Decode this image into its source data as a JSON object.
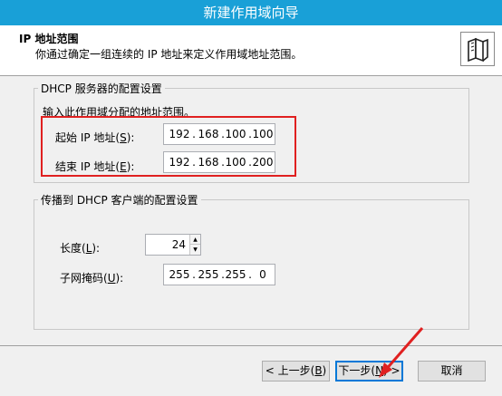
{
  "window": {
    "title": "新建作用域向导"
  },
  "header": {
    "title": "IP 地址范围",
    "description": "你通过确定一组连续的 IP 地址来定义作用域地址范围。"
  },
  "dhcp_group": {
    "legend": "DHCP 服务器的配置设置",
    "prompt": "输入此作用域分配的地址范围。",
    "start_label_pre": "起始 IP 地址(",
    "start_label_key": "S",
    "start_label_post": "):",
    "start_ip": [
      "192",
      "168",
      "100",
      "100"
    ],
    "end_label_pre": "结束 IP 地址(",
    "end_label_key": "E",
    "end_label_post": "):",
    "end_ip": [
      "192",
      "168",
      "100",
      "200"
    ]
  },
  "client_group": {
    "legend": "传播到 DHCP 客户端的配置设置",
    "length_label_pre": "长度(",
    "length_label_key": "L",
    "length_label_post": "):",
    "length_value": "24",
    "mask_label_pre": "子网掩码(",
    "mask_label_key": "U",
    "mask_label_post": "):",
    "mask": [
      "255",
      "255",
      "255",
      "0"
    ]
  },
  "footer": {
    "back_pre": "< 上一步(",
    "back_key": "B",
    "back_post": ")",
    "next_pre": "下一步(",
    "next_key": "N",
    "next_post": ") >",
    "cancel": "取消"
  },
  "colors": {
    "titlebar": "#19a0d7",
    "highlight": "#e02020",
    "accent": "#0078d7"
  }
}
